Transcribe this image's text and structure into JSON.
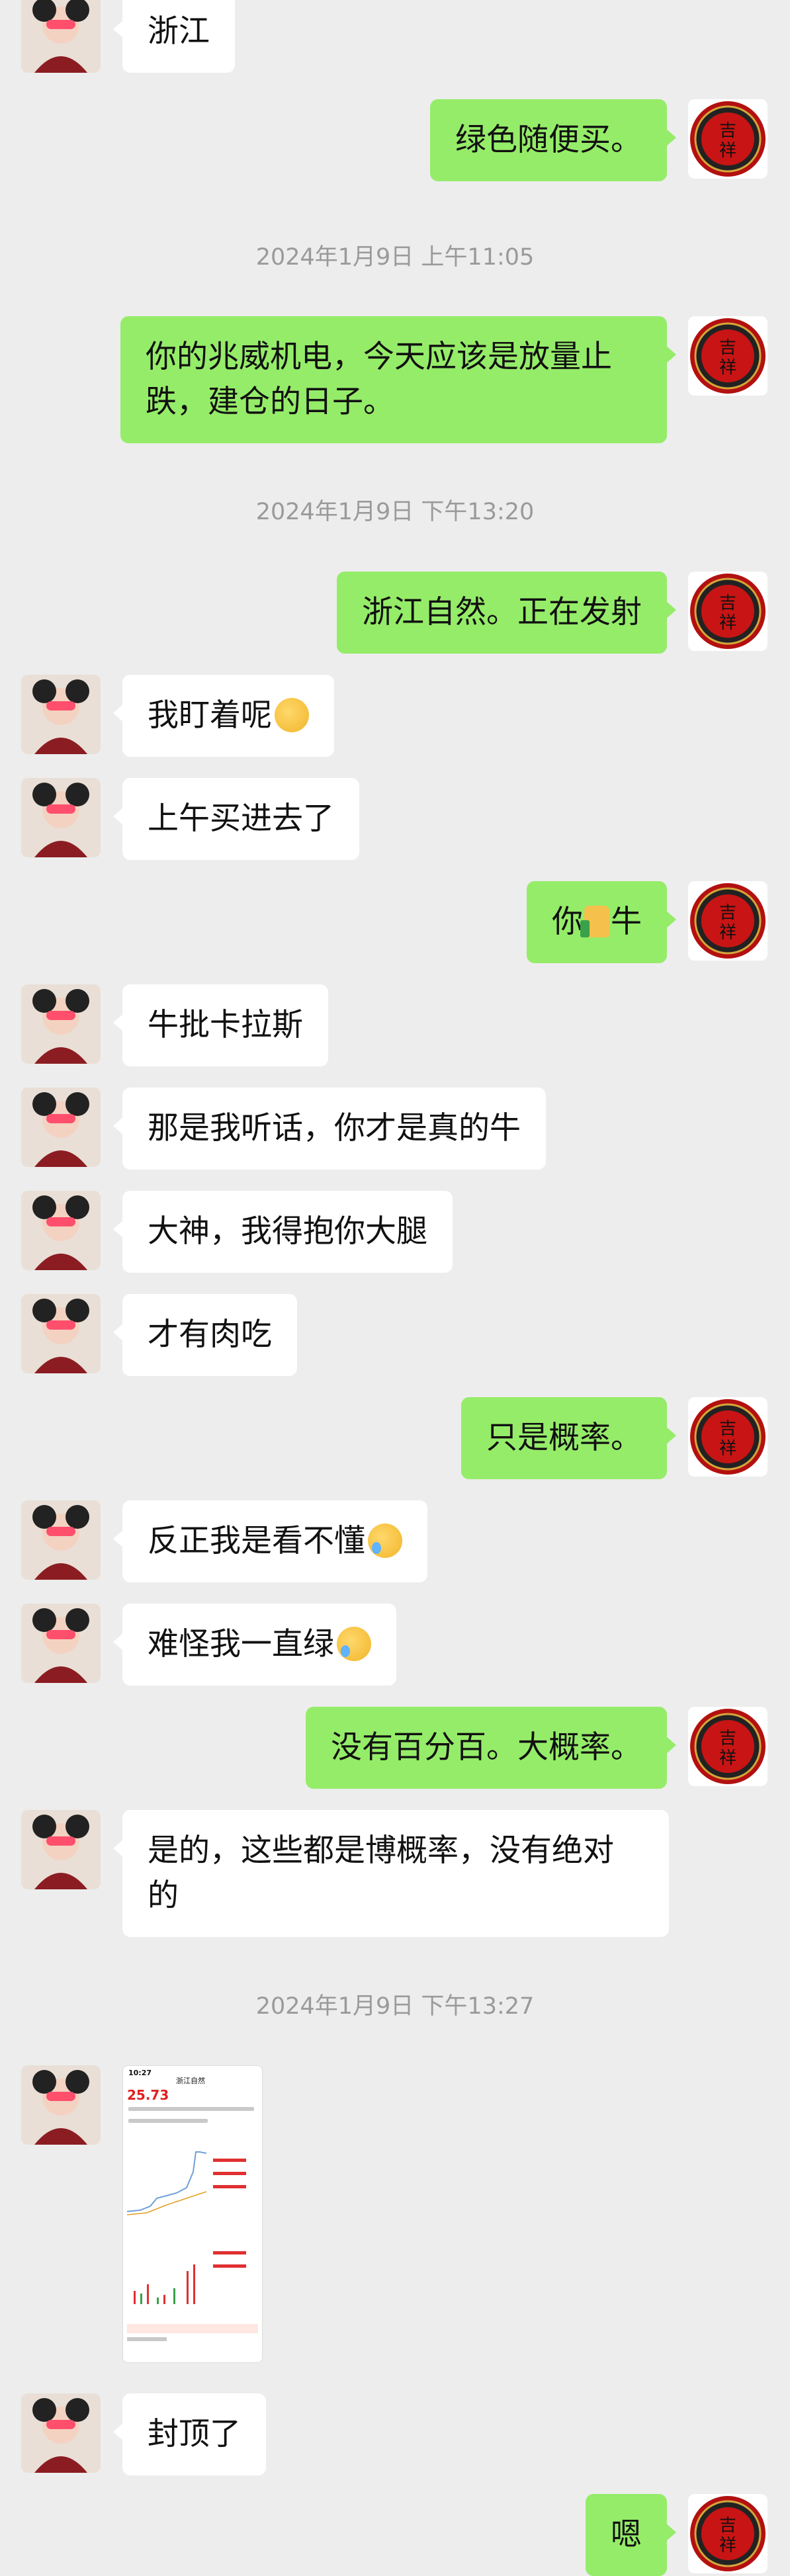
{
  "colors": {
    "background": "#ededed",
    "self_bubble": "#95ec69",
    "other_bubble": "#ffffff",
    "timestamp": "#9a9a9a"
  },
  "messages": [
    {
      "side": "left",
      "text": "浙江"
    },
    {
      "side": "right",
      "text": "绿色随便买。"
    },
    {
      "timestamp": "2024年1月9日 上午11:05"
    },
    {
      "side": "right",
      "text": "你的兆威机电，今天应该是放量止跌，建仓的日子。"
    },
    {
      "timestamp": "2024年1月9日 下午13:20"
    },
    {
      "side": "right",
      "text": "浙江自然。正在发射"
    },
    {
      "side": "left",
      "text": "我盯着呢",
      "emoji": "thinking-emoji"
    },
    {
      "side": "left",
      "text": "上午买进去了"
    },
    {
      "side": "right",
      "text_before": "你",
      "emoji": "thumbs-up-emoji",
      "text_after": "牛"
    },
    {
      "side": "left",
      "text": "牛批卡拉斯"
    },
    {
      "side": "left",
      "text": "那是我听话，你才是真的牛"
    },
    {
      "side": "left",
      "text": "大神，我得抱你大腿"
    },
    {
      "side": "left",
      "text": "才有肉吃"
    },
    {
      "side": "right",
      "text": "只是概率。"
    },
    {
      "side": "left",
      "text": "反正我是看不懂",
      "emoji": "laughing-tears-emoji"
    },
    {
      "side": "left",
      "text": "难怪我一直绿",
      "emoji": "laughing-tears-emoji"
    },
    {
      "side": "right",
      "text": "没有百分百。大概率。"
    },
    {
      "side": "left",
      "text": "是的，这些都是博概率，没有绝对的"
    },
    {
      "timestamp": "2024年1月9日 下午13:27"
    },
    {
      "side": "left",
      "image": "stock-app-screenshot",
      "image_text": {
        "time": "10:27",
        "price": "25.73",
        "title": "浙江自然"
      }
    },
    {
      "side": "left",
      "text": "封顶了"
    },
    {
      "side": "right",
      "text": "嗯"
    }
  ]
}
